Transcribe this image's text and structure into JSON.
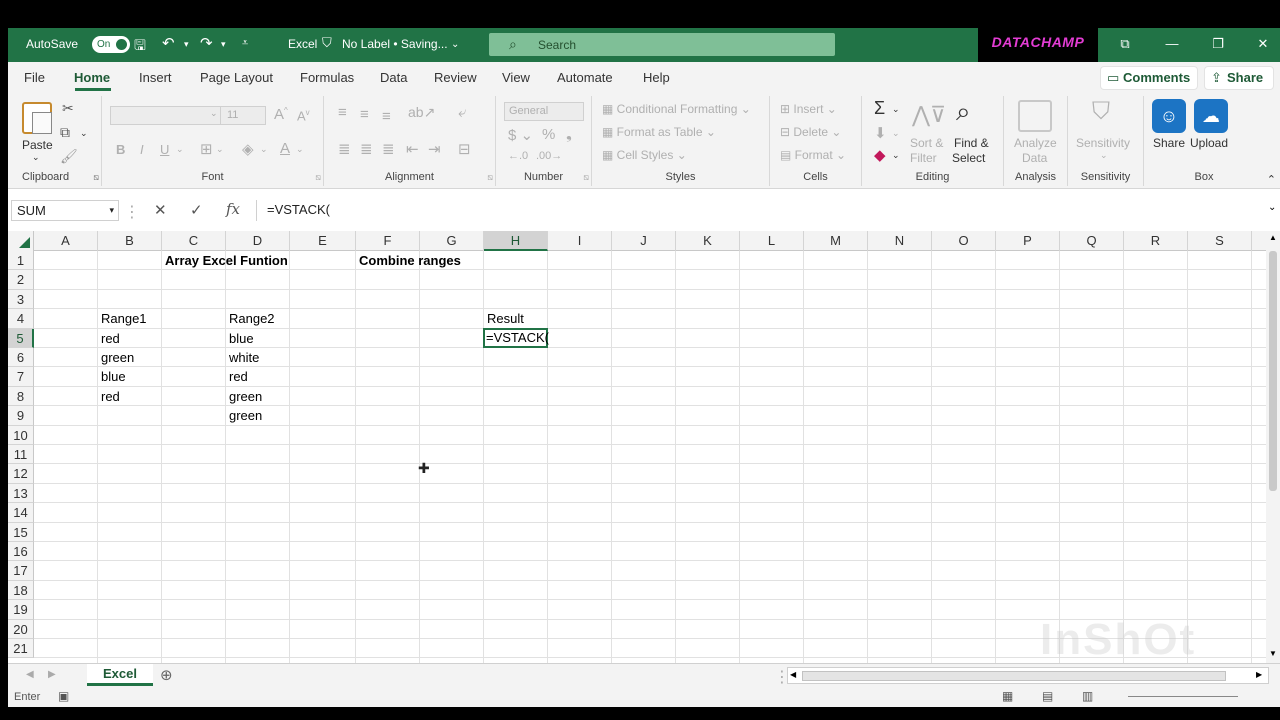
{
  "titlebar": {
    "autosave_label": "AutoSave",
    "autosave_state": "On",
    "app_name": "Excel",
    "label_status": "No Label • Saving...",
    "search_placeholder": "Search",
    "brand_logo": "DATACHAMP"
  },
  "menu": {
    "tabs": [
      "File",
      "Home",
      "Insert",
      "Page Layout",
      "Formulas",
      "Data",
      "Review",
      "View",
      "Automate",
      "Help"
    ],
    "active_tab": "Home",
    "comments_label": "Comments",
    "share_label": "Share"
  },
  "ribbon": {
    "clipboard": {
      "label": "Clipboard",
      "paste": "Paste"
    },
    "font": {
      "label": "Font",
      "size": "11",
      "bold": "B",
      "italic": "I",
      "underline": "U"
    },
    "alignment": {
      "label": "Alignment"
    },
    "number": {
      "label": "Number",
      "format": "General"
    },
    "styles": {
      "label": "Styles",
      "conditional": "Conditional Formatting",
      "format_table": "Format as Table",
      "cell_styles": "Cell Styles"
    },
    "cells": {
      "label": "Cells",
      "insert": "Insert",
      "delete": "Delete",
      "format": "Format"
    },
    "editing": {
      "label": "Editing",
      "sort1": "Sort &",
      "sort2": "Filter",
      "find1": "Find &",
      "find2": "Select"
    },
    "analysis": {
      "label": "Analysis",
      "analyze1": "Analyze",
      "analyze2": "Data"
    },
    "sensitivity": {
      "label": "Sensitivity",
      "btn": "Sensitivity"
    },
    "box": {
      "label": "Box",
      "share": "Share",
      "upload": "Upload"
    }
  },
  "formula_bar": {
    "name_box": "SUM",
    "fx": "fx",
    "formula": "=VSTACK("
  },
  "grid": {
    "columns": [
      "A",
      "B",
      "C",
      "D",
      "E",
      "F",
      "G",
      "H",
      "I",
      "J",
      "K",
      "L",
      "M",
      "N",
      "O",
      "P",
      "Q",
      "R",
      "S"
    ],
    "rows": [
      "1",
      "2",
      "3",
      "4",
      "5",
      "6",
      "7",
      "8",
      "9",
      "10",
      "11",
      "12",
      "13",
      "14",
      "15",
      "16",
      "17",
      "18",
      "19",
      "20",
      "21"
    ],
    "selected_column": "H",
    "selected_row": "5",
    "cells": {
      "C1": "Array Excel Funtion",
      "F1": "Combine ranges",
      "B4": "Range1",
      "D4": "Range2",
      "H4": "Result",
      "B5": "red",
      "D5": "blue",
      "B6": "green",
      "D6": "white",
      "B7": "blue",
      "D7": "red",
      "B8": "red",
      "D8": "green",
      "D9": "green"
    },
    "active_cell_value": "=VSTACK("
  },
  "sheets": {
    "active": "Excel"
  },
  "status": {
    "mode": "Enter"
  },
  "colors": {
    "excel_green": "#217346",
    "brand_pink": "#e33cd4"
  }
}
